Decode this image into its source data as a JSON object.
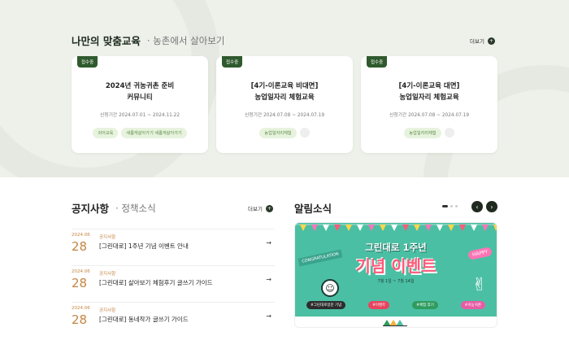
{
  "section_edu": {
    "title": "나만의 맞춤교육",
    "subtitle": "· 농촌에서 살아보기",
    "more": "더보기"
  },
  "cards": [
    {
      "badge": "접수중",
      "title_line1": "2024년 귀농귀촌 준비",
      "title_line2": "커뮤니티",
      "period": "신청기간 2024.07.01 ~ 2024.11.22",
      "tags": [
        "귀어교육",
        "새롭게살아가기 새롭게살아가기"
      ]
    },
    {
      "badge": "접수중",
      "title_line1": "[4기-이론교육 비대면]",
      "title_line2": "농업일자리 체험교육",
      "period": "신청기간 2024.07.08 ~ 2024.07.19",
      "tags": [
        "농업일자리체험"
      ]
    },
    {
      "badge": "접수중",
      "title_line1": "[4기-이론교육 대면]",
      "title_line2": "농업일자리 체험교육",
      "period": "신청기간 2024.07.08 ~ 2024.07.19",
      "tags": [
        "농업일자리체험"
      ]
    }
  ],
  "section_notice": {
    "title": "공지사항",
    "subtitle": "· 정책소식",
    "more": "더보기"
  },
  "notices": [
    {
      "ym": "2024.06",
      "day": "28",
      "category": "공지사항",
      "text": "[그린대로] 1주년 기념 이벤트 안내"
    },
    {
      "ym": "2024.06",
      "day": "28",
      "category": "공지사항",
      "text": "[그린대로] 살아보기 체험후기 글쓰기 가이드"
    },
    {
      "ym": "2024.06",
      "day": "28",
      "category": "공지사항",
      "text": "[그린대로] 동네작가 글쓰기 가이드"
    }
  ],
  "section_alarm": {
    "title": "알림소식"
  },
  "banner": {
    "sub": "그린대로 1주년",
    "main": "기념 이벤트",
    "congrats": "CONGRATULATION",
    "happy": "HAPPY",
    "dates": "7월 1일 ~ 7월 14일",
    "pills": [
      "#그린대로방문 기념",
      "#이벤트",
      "#체험 후기",
      "#귀농귀촌"
    ]
  },
  "colors": {
    "accent_green": "#2e5a2e",
    "highlight": "#bfe0a4",
    "notice_date": "#c48542",
    "banner_bg": "#4bbfa3"
  }
}
